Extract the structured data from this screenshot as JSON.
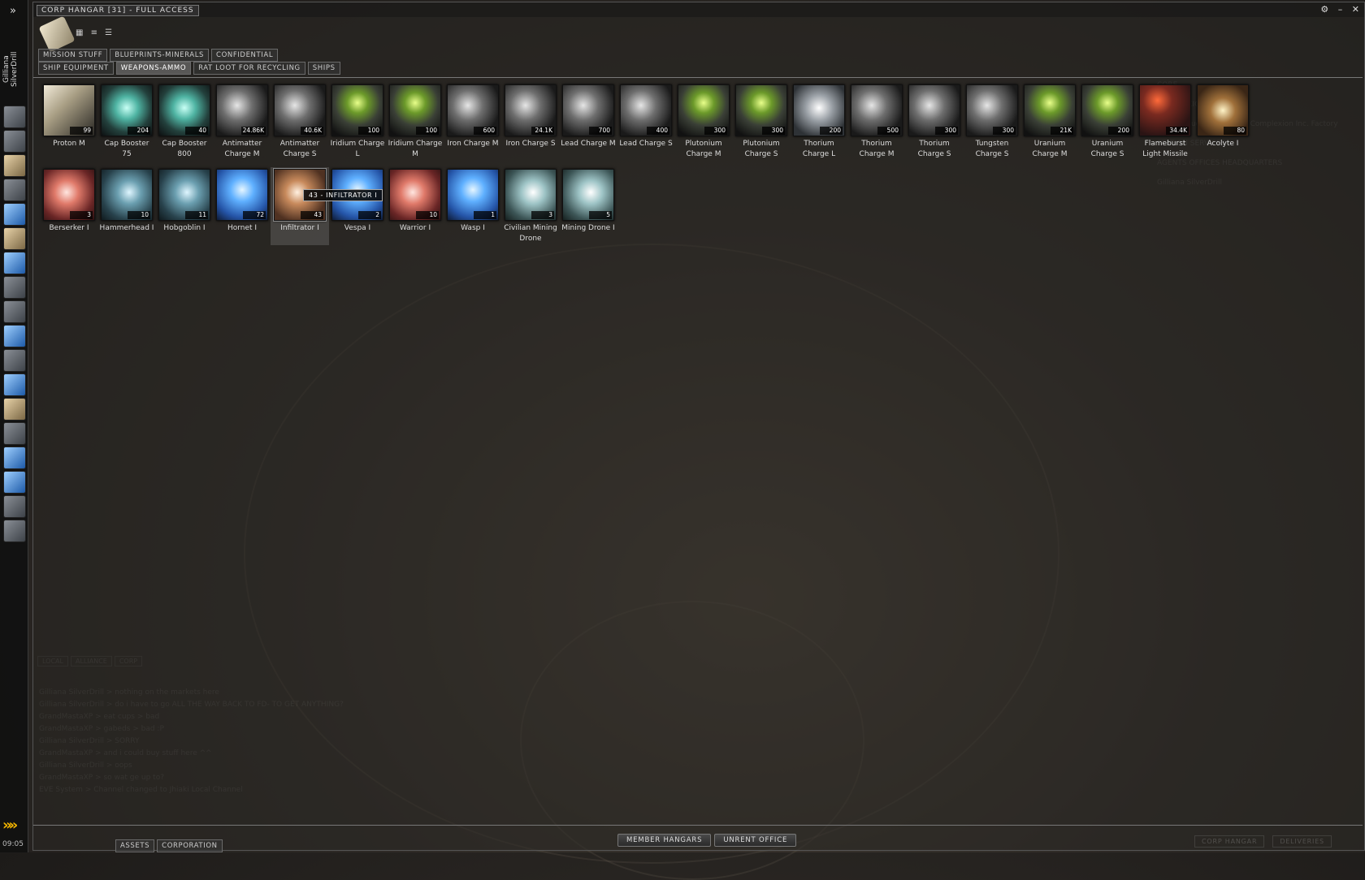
{
  "window": {
    "title": "CORP HANGAR [31] - FULL ACCESS",
    "controls": [
      "⚙",
      "–",
      "✕"
    ]
  },
  "neocom": {
    "toggle": "»",
    "character_name": "Gilliana SilverDrill",
    "expand": "»»",
    "clock": "09:05"
  },
  "view_icons": "▦ ≡ ☰",
  "tabs_row1": [
    "MISSION STUFF",
    "BLUEPRINTS-MINERALS",
    "CONFIDENTIAL"
  ],
  "tabs_row2": [
    "SHIP EQUIPMENT",
    "WEAPONS-AMMO",
    "RAT LOOT FOR RECYCLING",
    "SHIPS"
  ],
  "active_tab": "WEAPONS-AMMO",
  "items_row1": [
    {
      "name": "Proton M",
      "qty": "99",
      "style": "t-proton"
    },
    {
      "name": "Cap Booster 75",
      "qty": "204",
      "style": "t-cap"
    },
    {
      "name": "Cap Booster 800",
      "qty": "40",
      "style": "t-cap"
    },
    {
      "name": "Antimatter Charge M",
      "qty": "24.86K",
      "style": "t-ammo"
    },
    {
      "name": "Antimatter Charge S",
      "qty": "40.6K",
      "style": "t-ammo"
    },
    {
      "name": "Iridium Charge L",
      "qty": "100",
      "style": "t-green"
    },
    {
      "name": "Iridium Charge M",
      "qty": "100",
      "style": "t-green"
    },
    {
      "name": "Iron Charge M",
      "qty": "600",
      "style": "t-ammo"
    },
    {
      "name": "Iron Charge S",
      "qty": "24.1K",
      "style": "t-ammo"
    },
    {
      "name": "Lead Charge M",
      "qty": "700",
      "style": "t-ammo"
    },
    {
      "name": "Lead Charge S",
      "qty": "400",
      "style": "t-ammo"
    },
    {
      "name": "Plutonium Charge M",
      "qty": "300",
      "style": "t-green"
    },
    {
      "name": "Plutonium Charge S",
      "qty": "300",
      "style": "t-green"
    },
    {
      "name": "Thorium Charge L",
      "qty": "200",
      "style": "t-can"
    },
    {
      "name": "Thorium Charge M",
      "qty": "500",
      "style": "t-ammo"
    },
    {
      "name": "Thorium Charge S",
      "qty": "300",
      "style": "t-ammo"
    },
    {
      "name": "Tungsten Charge S",
      "qty": "300",
      "style": "t-ammo"
    },
    {
      "name": "Uranium Charge M",
      "qty": "21K",
      "style": "t-green"
    },
    {
      "name": "Uranium Charge S",
      "qty": "200",
      "style": "t-green"
    },
    {
      "name": "Flameburst Light Missile",
      "qty": "34.4K",
      "style": "t-missile"
    },
    {
      "name": "Acolyte I",
      "qty": "80",
      "style": "t-acolyte"
    }
  ],
  "items_row2": [
    {
      "name": "Berserker I",
      "qty": "3",
      "style": "t-red"
    },
    {
      "name": "Hammerhead I",
      "qty": "10",
      "style": "t-teal"
    },
    {
      "name": "Hobgoblin I",
      "qty": "11",
      "style": "t-teal"
    },
    {
      "name": "Hornet I",
      "qty": "72",
      "style": "t-blue"
    },
    {
      "name": "Infiltrator I",
      "qty": "43",
      "style": "t-brown"
    },
    {
      "name": "Vespa I",
      "qty": "2",
      "style": "t-blue"
    },
    {
      "name": "Warrior I",
      "qty": "10",
      "style": "t-red"
    },
    {
      "name": "Wasp I",
      "qty": "1",
      "style": "t-blue"
    },
    {
      "name": "Civilian Mining Drone",
      "qty": "3",
      "style": "t-mining"
    },
    {
      "name": "Mining Drone I",
      "qty": "5",
      "style": "t-mining"
    }
  ],
  "selected_item": "Infiltrator I",
  "tooltip": "43 - INFILTRATOR I",
  "chat": {
    "tabs": [
      "LOCAL",
      "ALLIANCE",
      "CORP"
    ],
    "lines": [
      "Gilliana SilverDrill > nothing on the markets here",
      "Gilliana SilverDrill > do i have to go ALL THE WAY BACK TO FD- TO GET ANYTHING?",
      "GrandMastaXP > eat cups > bad",
      "GrandMastaXP > gabeds > bad :P",
      "Gilliana SilverDrill > SORRY",
      "GrandMastaXP > and i could buy stuff here ^^",
      "Gilliana SilverDrill > oops",
      "GrandMastaXP > so wat ge up to?",
      "EVE System > Channel changed to Jhiaki Local Channel"
    ]
  },
  "right_panel": {
    "lines": [
      "CORE",
      "COMPLEXION",
      "Station   Ouguno IV - Core Complexion Inc. Factory",
      "STATION SERVICES",
      "AGENTS  OFFICES  HEADQUARTERS",
      "Gilliana SilverDrill"
    ]
  },
  "bottom_tabs": [
    "ASSETS",
    "CORPORATION"
  ],
  "center_buttons": [
    "MEMBER HANGARS",
    "UNRENT OFFICE"
  ],
  "bottom_right": [
    "CORP HANGAR",
    "DELIVERIES"
  ]
}
